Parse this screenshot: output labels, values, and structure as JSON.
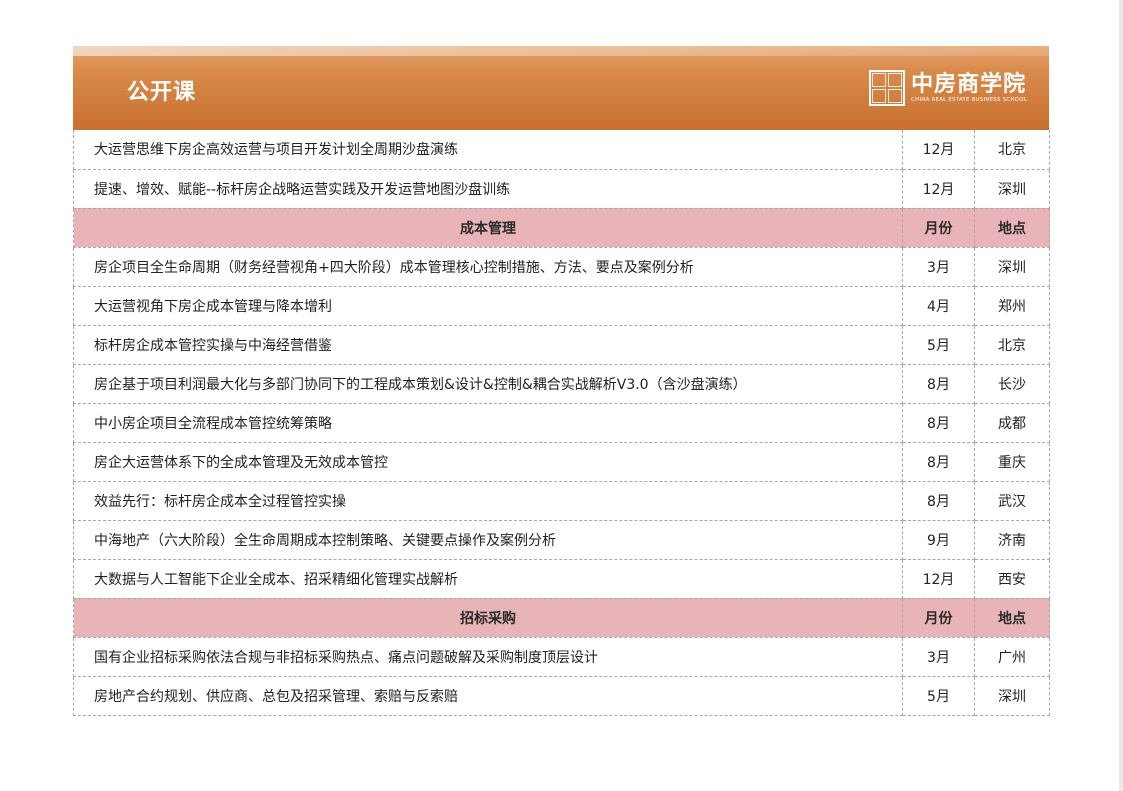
{
  "header": {
    "title": "公开课",
    "logo_cn": "中房商学院",
    "logo_en": "CHINA REAL ESTATE BUSINESS SCHOOL"
  },
  "rows": [
    {
      "type": "course",
      "name": "大运营思维下房企高效运营与项目开发计划全周期沙盘演练",
      "month": "12月",
      "city": "北京"
    },
    {
      "type": "course",
      "name": "提速、增效、赋能--标杆房企战略运营实践及开发运营地图沙盘训练",
      "month": "12月",
      "city": "深圳"
    },
    {
      "type": "section",
      "name": "成本管理",
      "month": "月份",
      "city": "地点"
    },
    {
      "type": "course",
      "name": "房企项目全生命周期（财务经营视角+四大阶段）成本管理核心控制措施、方法、要点及案例分析",
      "month": "3月",
      "city": "深圳"
    },
    {
      "type": "course",
      "name": "大运营视角下房企成本管理与降本增利",
      "month": "4月",
      "city": "郑州"
    },
    {
      "type": "course",
      "name": "标杆房企成本管控实操与中海经营借鉴",
      "month": "5月",
      "city": "北京"
    },
    {
      "type": "course",
      "name": "房企基于项目利润最大化与多部门协同下的工程成本策划&设计&控制&耦合实战解析V3.0（含沙盘演练）",
      "month": "8月",
      "city": "长沙"
    },
    {
      "type": "course",
      "name": "中小房企项目全流程成本管控统筹策略",
      "month": "8月",
      "city": "成都"
    },
    {
      "type": "course",
      "name": "房企大运营体系下的全成本管理及无效成本管控",
      "month": "8月",
      "city": "重庆"
    },
    {
      "type": "course",
      "name": "效益先行：标杆房企成本全过程管控实操",
      "month": "8月",
      "city": "武汉"
    },
    {
      "type": "course",
      "name": "中海地产（六大阶段）全生命周期成本控制策略、关键要点操作及案例分析",
      "month": "9月",
      "city": "济南"
    },
    {
      "type": "course",
      "name": "大数据与人工智能下企业全成本、招采精细化管理实战解析",
      "month": "12月",
      "city": "西安"
    },
    {
      "type": "section",
      "name": "招标采购",
      "month": "月份",
      "city": "地点"
    },
    {
      "type": "course",
      "name": "国有企业招标采购依法合规与非招标采购热点、痛点问题破解及采购制度顶层设计",
      "month": "3月",
      "city": "广州"
    },
    {
      "type": "course",
      "name": "房地产合约规划、供应商、总包及招采管理、索赔与反索赔",
      "month": "5月",
      "city": "深圳"
    }
  ]
}
